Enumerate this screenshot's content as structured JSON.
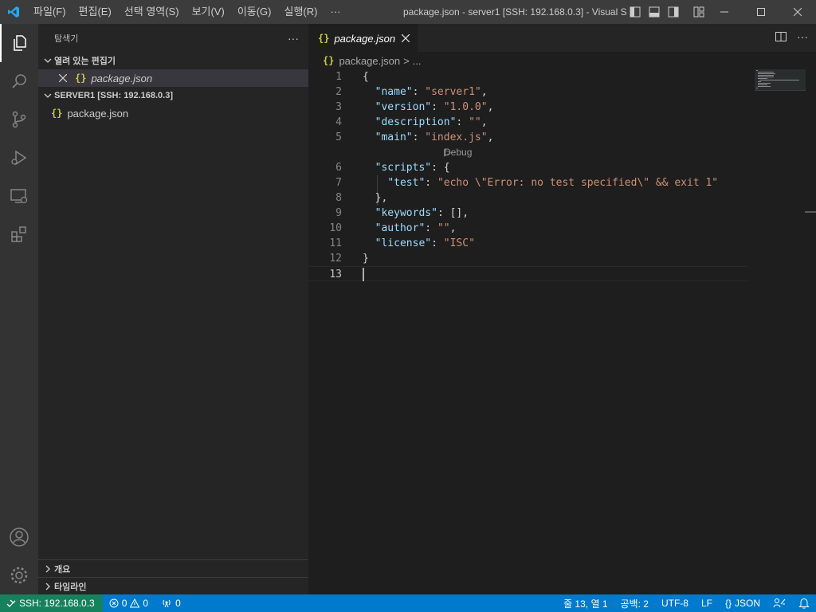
{
  "titlebar": {
    "menu": [
      "파일(F)",
      "편집(E)",
      "선택 영역(S)",
      "보기(V)",
      "이동(G)",
      "실행(R)",
      "···"
    ],
    "window_title": "package.json - server1 [SSH: 192.168.0.3] - Visual S..."
  },
  "activity_bar": {
    "items": [
      "explorer-icon",
      "search-icon",
      "source-control-icon",
      "run-debug-icon",
      "remote-explorer-icon",
      "extensions-icon"
    ],
    "bottom": [
      "account-icon",
      "settings-gear-icon"
    ]
  },
  "sidebar": {
    "title": "탐색기",
    "more": "···",
    "open_editors": {
      "label": "열려 있는 편집기",
      "files": [
        {
          "icon": "{}",
          "name": "package.json"
        }
      ]
    },
    "workspace": {
      "label": "SERVER1 [SSH: 192.168.0.3]",
      "files": [
        {
          "icon": "{}",
          "name": "package.json"
        }
      ]
    },
    "outline_label": "개요",
    "timeline_label": "타임라인"
  },
  "editor": {
    "tab": {
      "icon": "{}",
      "label": "package.json"
    },
    "breadcrumb": {
      "icon": "{}",
      "file": "package.json",
      "sep": ">",
      "more": "..."
    },
    "codelens": "Debug",
    "lines": [
      {
        "n": "1",
        "text": "{"
      },
      {
        "n": "2",
        "text": "  \"name\": \"server1\","
      },
      {
        "n": "3",
        "text": "  \"version\": \"1.0.0\","
      },
      {
        "n": "4",
        "text": "  \"description\": \"\","
      },
      {
        "n": "5",
        "text": "  \"main\": \"index.js\","
      },
      {
        "n": "6",
        "text": "  \"scripts\": {"
      },
      {
        "n": "7",
        "text": "    \"test\": \"echo \\\"Error: no test specified\\\" && exit 1\""
      },
      {
        "n": "8",
        "text": "  },"
      },
      {
        "n": "9",
        "text": "  \"keywords\": [],"
      },
      {
        "n": "10",
        "text": "  \"author\": \"\","
      },
      {
        "n": "11",
        "text": "  \"license\": \"ISC\""
      },
      {
        "n": "12",
        "text": "}"
      },
      {
        "n": "13",
        "text": ""
      }
    ]
  },
  "statusbar": {
    "remote": "SSH: 192.168.0.3",
    "errors": "0",
    "warnings": "0",
    "ports": "0",
    "position": "줄 13, 열 1",
    "spaces": "공백: 2",
    "encoding": "UTF-8",
    "eol": "LF",
    "language_icon": "{}",
    "language": "JSON"
  },
  "colors": {
    "accent": "#007acc",
    "remote": "#16825d",
    "json_icon": "#cbcb41",
    "key": "#9cdcfe",
    "string": "#ce9178"
  }
}
